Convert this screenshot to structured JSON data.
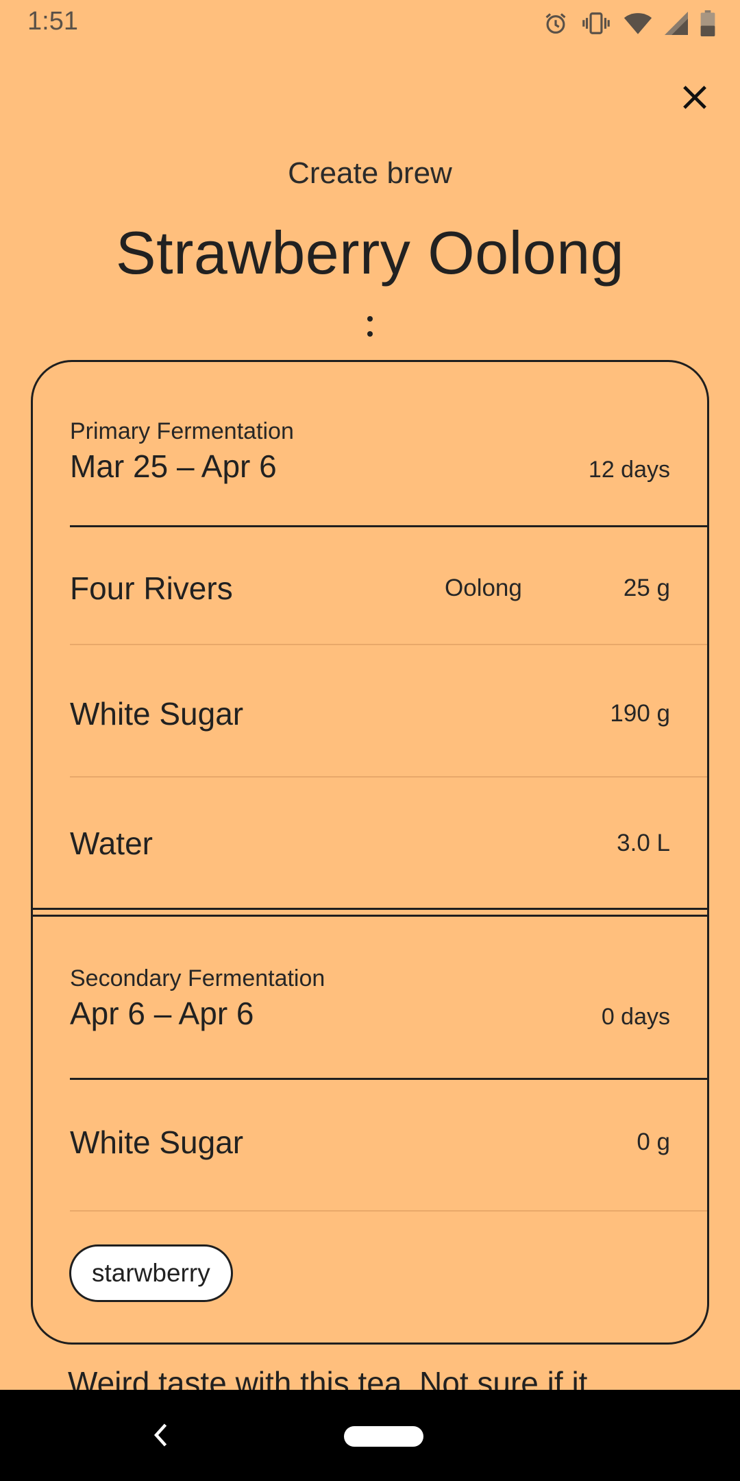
{
  "status_bar": {
    "time": "1:51",
    "icons": [
      "alarm-icon",
      "vibrate-icon",
      "wifi-icon",
      "signal-icon",
      "battery-icon"
    ]
  },
  "header": {
    "close_icon": "close-icon",
    "create_label": "Create brew",
    "title": "Strawberry Oolong",
    "more_icon": "more-vertical-icon"
  },
  "primary": {
    "label": "Primary Fermentation",
    "dates": "Mar 25 – Apr 6",
    "days": "12 days",
    "ingredients": [
      {
        "name": "Four Rivers",
        "type": "Oolong",
        "amount": "25 g"
      },
      {
        "name": "White Sugar",
        "type": "",
        "amount": "190 g"
      },
      {
        "name": "Water",
        "type": "",
        "amount": "3.0 L"
      }
    ]
  },
  "secondary": {
    "label": "Secondary Fermentation",
    "dates": "Apr 6 – Apr 6",
    "days": "0 days",
    "ingredients": [
      {
        "name": "White Sugar",
        "type": "",
        "amount": "0 g"
      }
    ],
    "tags": [
      "starwberry"
    ]
  },
  "note": "Weird taste with this tea. Not sure if it",
  "colors": {
    "background": "#FFBF7D",
    "text": "#212121",
    "nav_bar": "#000000"
  }
}
